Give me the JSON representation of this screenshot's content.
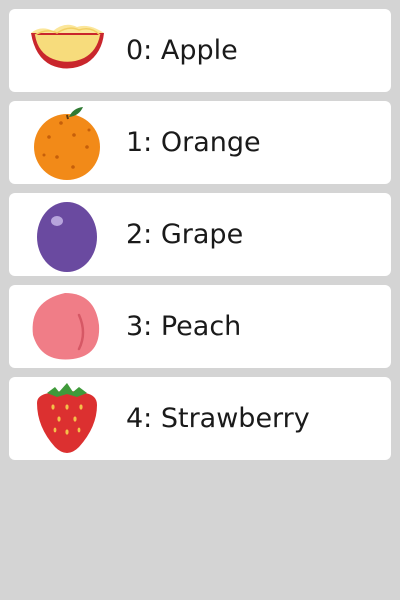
{
  "items": [
    {
      "label": "0: Apple",
      "icon": "apple-slice-icon"
    },
    {
      "label": "1: Orange",
      "icon": "orange-icon"
    },
    {
      "label": "2: Grape",
      "icon": "grape-icon"
    },
    {
      "label": "3: Peach",
      "icon": "peach-icon"
    },
    {
      "label": "4: Strawberry",
      "icon": "strawberry-icon"
    }
  ],
  "colors": {
    "background": "#d4d4d4",
    "card": "#ffffff",
    "text": "#1a1a1a"
  }
}
